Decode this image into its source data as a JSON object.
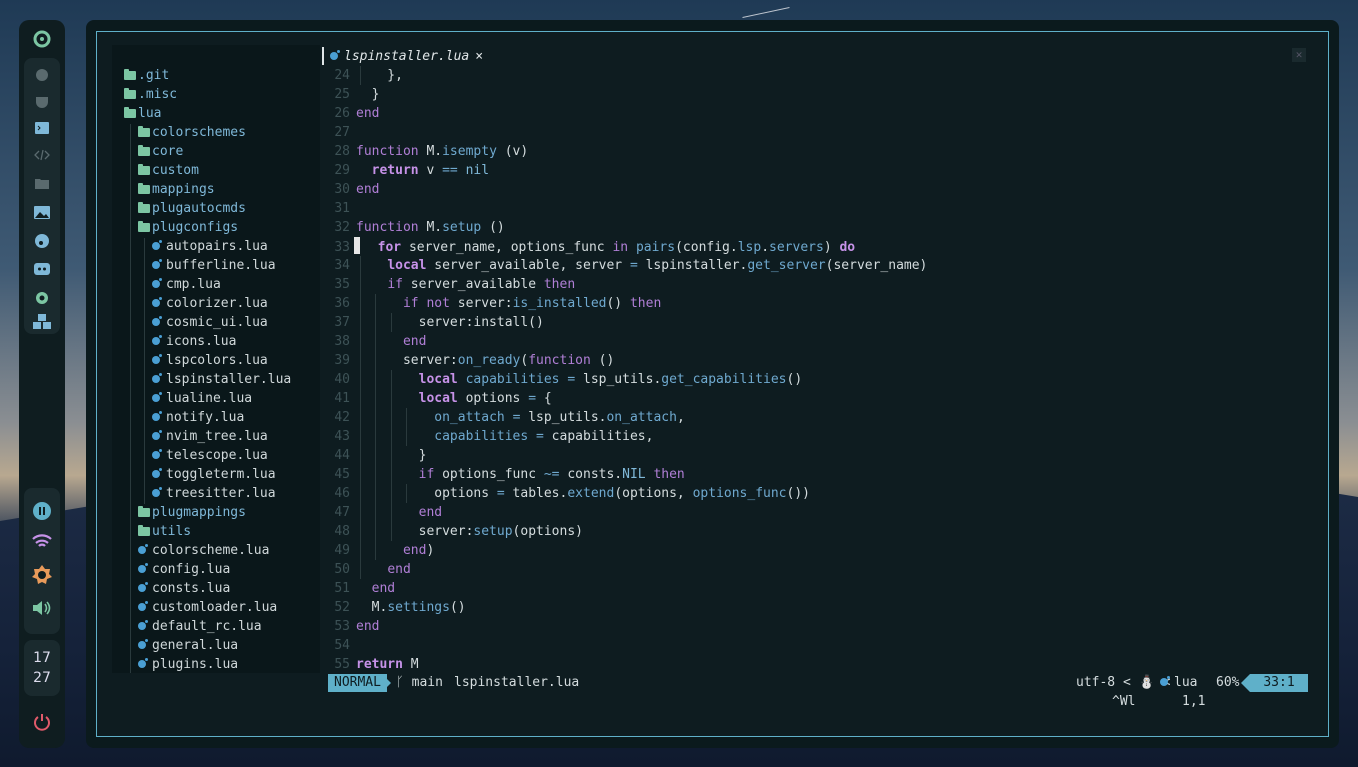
{
  "dock": {
    "clock_hour": "17",
    "clock_minute": "27",
    "top_icons": [
      "ubuntu-logo-icon",
      "firefox-icon",
      "pocket-icon",
      "terminal-icon",
      "code-icon",
      "folder-icon",
      "image-icon",
      "music-icon",
      "discord-icon",
      "gear-icon",
      "cubes-icon"
    ],
    "status_icons": [
      "pause-icon",
      "wifi-icon",
      "brightness-icon",
      "volume-icon"
    ],
    "power_icon": "power-icon"
  },
  "tab": {
    "filename": "lspinstaller.lua",
    "close": "×"
  },
  "tree": [
    {
      "label": ".git",
      "type": "folder",
      "depth": 0
    },
    {
      "label": ".misc",
      "type": "folder",
      "depth": 0
    },
    {
      "label": "lua",
      "type": "folder",
      "depth": 0
    },
    {
      "label": "colorschemes",
      "type": "folder",
      "depth": 1
    },
    {
      "label": "core",
      "type": "folder",
      "depth": 1
    },
    {
      "label": "custom",
      "type": "folder",
      "depth": 1
    },
    {
      "label": "mappings",
      "type": "folder",
      "depth": 1
    },
    {
      "label": "plugautocmds",
      "type": "folder",
      "depth": 1
    },
    {
      "label": "plugconfigs",
      "type": "folder",
      "depth": 1
    },
    {
      "label": "autopairs.lua",
      "type": "file",
      "depth": 2
    },
    {
      "label": "bufferline.lua",
      "type": "file",
      "depth": 2
    },
    {
      "label": "cmp.lua",
      "type": "file",
      "depth": 2
    },
    {
      "label": "colorizer.lua",
      "type": "file",
      "depth": 2
    },
    {
      "label": "cosmic_ui.lua",
      "type": "file",
      "depth": 2
    },
    {
      "label": "icons.lua",
      "type": "file",
      "depth": 2
    },
    {
      "label": "lspcolors.lua",
      "type": "file",
      "depth": 2
    },
    {
      "label": "lspinstaller.lua",
      "type": "file",
      "depth": 2
    },
    {
      "label": "lualine.lua",
      "type": "file",
      "depth": 2
    },
    {
      "label": "notify.lua",
      "type": "file",
      "depth": 2
    },
    {
      "label": "nvim_tree.lua",
      "type": "file",
      "depth": 2
    },
    {
      "label": "telescope.lua",
      "type": "file",
      "depth": 2
    },
    {
      "label": "toggleterm.lua",
      "type": "file",
      "depth": 2
    },
    {
      "label": "treesitter.lua",
      "type": "file",
      "depth": 2
    },
    {
      "label": "plugmappings",
      "type": "folder",
      "depth": 1
    },
    {
      "label": "utils",
      "type": "folder",
      "depth": 1
    },
    {
      "label": "colorscheme.lua",
      "type": "file",
      "depth": 1
    },
    {
      "label": "config.lua",
      "type": "file",
      "depth": 1
    },
    {
      "label": "consts.lua",
      "type": "file",
      "depth": 1
    },
    {
      "label": "customloader.lua",
      "type": "file",
      "depth": 1
    },
    {
      "label": "default_rc.lua",
      "type": "file",
      "depth": 1
    },
    {
      "label": "general.lua",
      "type": "file",
      "depth": 1
    },
    {
      "label": "plugins.lua",
      "type": "file",
      "depth": 1
    }
  ],
  "code_lines": [
    {
      "n": "24",
      "text": "    },"
    },
    {
      "n": "25",
      "text": "  }"
    },
    {
      "n": "26",
      "text": "end"
    },
    {
      "n": "27",
      "text": ""
    },
    {
      "n": "28",
      "text": "function M.isempty (v)"
    },
    {
      "n": "29",
      "text": "  return v == nil"
    },
    {
      "n": "30",
      "text": "end"
    },
    {
      "n": "31",
      "text": ""
    },
    {
      "n": "32",
      "text": "function M.setup ()"
    },
    {
      "n": "33",
      "text": "  for server_name, options_func in pairs(config.lsp.servers) do"
    },
    {
      "n": "34",
      "text": "    local server_available, server = lspinstaller.get_server(server_name)"
    },
    {
      "n": "35",
      "text": "    if server_available then"
    },
    {
      "n": "36",
      "text": "      if not server:is_installed() then"
    },
    {
      "n": "37",
      "text": "        server:install()"
    },
    {
      "n": "38",
      "text": "      end"
    },
    {
      "n": "39",
      "text": "      server:on_ready(function ()"
    },
    {
      "n": "40",
      "text": "        local capabilities = lsp_utils.get_capabilities()"
    },
    {
      "n": "41",
      "text": "        local options = {"
    },
    {
      "n": "42",
      "text": "          on_attach = lsp_utils.on_attach,"
    },
    {
      "n": "43",
      "text": "          capabilities = capabilities,"
    },
    {
      "n": "44",
      "text": "        }"
    },
    {
      "n": "45",
      "text": "        if options_func ~= consts.NIL then"
    },
    {
      "n": "46",
      "text": "          options = tables.extend(options, options_func())"
    },
    {
      "n": "47",
      "text": "        end"
    },
    {
      "n": "48",
      "text": "        server:setup(options)"
    },
    {
      "n": "49",
      "text": "      end)"
    },
    {
      "n": "50",
      "text": "    end"
    },
    {
      "n": "51",
      "text": "  end"
    },
    {
      "n": "52",
      "text": "  M.settings()"
    },
    {
      "n": "53",
      "text": "end"
    },
    {
      "n": "54",
      "text": ""
    },
    {
      "n": "55",
      "text": "return M"
    }
  ],
  "statusline": {
    "mode": "NORMAL",
    "branch": "main",
    "branch_icon": "git-branch-icon",
    "filename": "lspinstaller.lua",
    "encoding": "utf-8",
    "os_icon": "linux-penguin-icon",
    "filetype": "lua",
    "percent": "60%",
    "position": "33:1"
  },
  "cmdline": {
    "keys": "^Wl",
    "ruler": "1,1"
  },
  "colors": {
    "accent": "#5fb0c9",
    "keyword": "#b07fd6",
    "folder": "#7cc6a3",
    "lua": "#4a9fd4"
  }
}
